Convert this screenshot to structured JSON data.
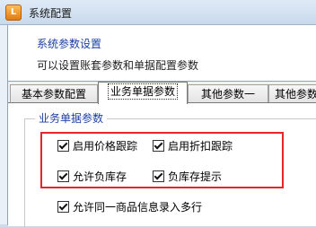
{
  "window": {
    "title": "系统配置"
  },
  "header": {
    "title": "系统参数设置",
    "description": "可以设置账套参数和单据配置参数"
  },
  "tabs": [
    {
      "label": "基本参数配置"
    },
    {
      "label": "业务单据参数"
    },
    {
      "label": "其他参数一"
    },
    {
      "label": "其他参数"
    }
  ],
  "group": {
    "title": "业务单据参数",
    "options": [
      {
        "label": "启用价格跟踪",
        "checked": true
      },
      {
        "label": "启用折扣跟踪",
        "checked": true
      },
      {
        "label": "允许负库存",
        "checked": true
      },
      {
        "label": "负库存提示",
        "checked": true
      },
      {
        "label": "允许同一商品信息录入多行",
        "checked": true
      }
    ]
  },
  "colors": {
    "highlight": "#e3272b",
    "header_title": "#1a3fa6"
  },
  "icons": {
    "app": "app-logo-icon"
  }
}
